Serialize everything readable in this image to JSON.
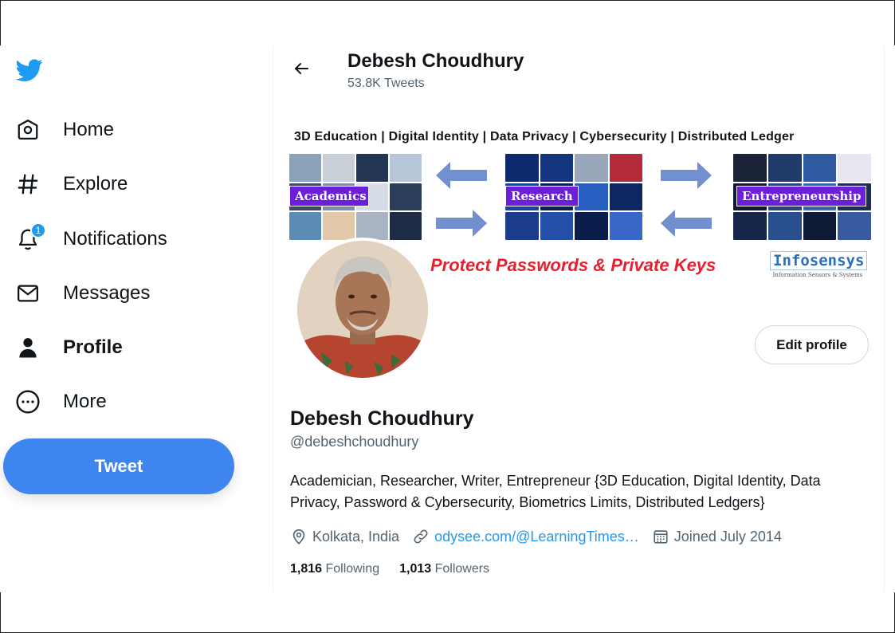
{
  "sidebar": {
    "items": [
      {
        "label": "Home",
        "icon": "home-icon"
      },
      {
        "label": "Explore",
        "icon": "hashtag-icon"
      },
      {
        "label": "Notifications",
        "icon": "bell-icon",
        "badge": "1"
      },
      {
        "label": "Messages",
        "icon": "envelope-icon"
      },
      {
        "label": "Profile",
        "icon": "person-icon",
        "active": true
      },
      {
        "label": "More",
        "icon": "more-circle-icon"
      }
    ],
    "tweet_label": "Tweet"
  },
  "header": {
    "name": "Debesh Choudhury",
    "tweet_count": "53.8K Tweets"
  },
  "banner": {
    "headline": "3D Education | Digital Identity | Data Privacy | Cybersecurity | Distributed Ledger",
    "tiles": [
      "Academics",
      "Research",
      "Entrepreneurship"
    ],
    "slogan": "Protect Passwords & Private Keys",
    "brand": "Infosensys",
    "brand_tagline": "Information Sensors & Systems"
  },
  "profile": {
    "edit_label": "Edit profile",
    "name": "Debesh Choudhury",
    "handle": "@debeshchoudhury",
    "bio": "Academician, Researcher, Writer, Entrepreneur {3D Education, Digital Identity, Data Privacy, Password & Cybersecurity, Biometrics Limits, Distributed Ledgers}",
    "location": "Kolkata, India",
    "website": "odysee.com/@LearningTimes…",
    "joined": "Joined July 2014",
    "following_count": "1,816",
    "following_label": "Following",
    "followers_count": "1,013",
    "followers_label": "Followers"
  },
  "colors": {
    "accent": "#1d9bf0",
    "tweet_button": "#3f85f0",
    "banner_label_bg": "#6c1fd9",
    "slogan": "#e7202f"
  }
}
